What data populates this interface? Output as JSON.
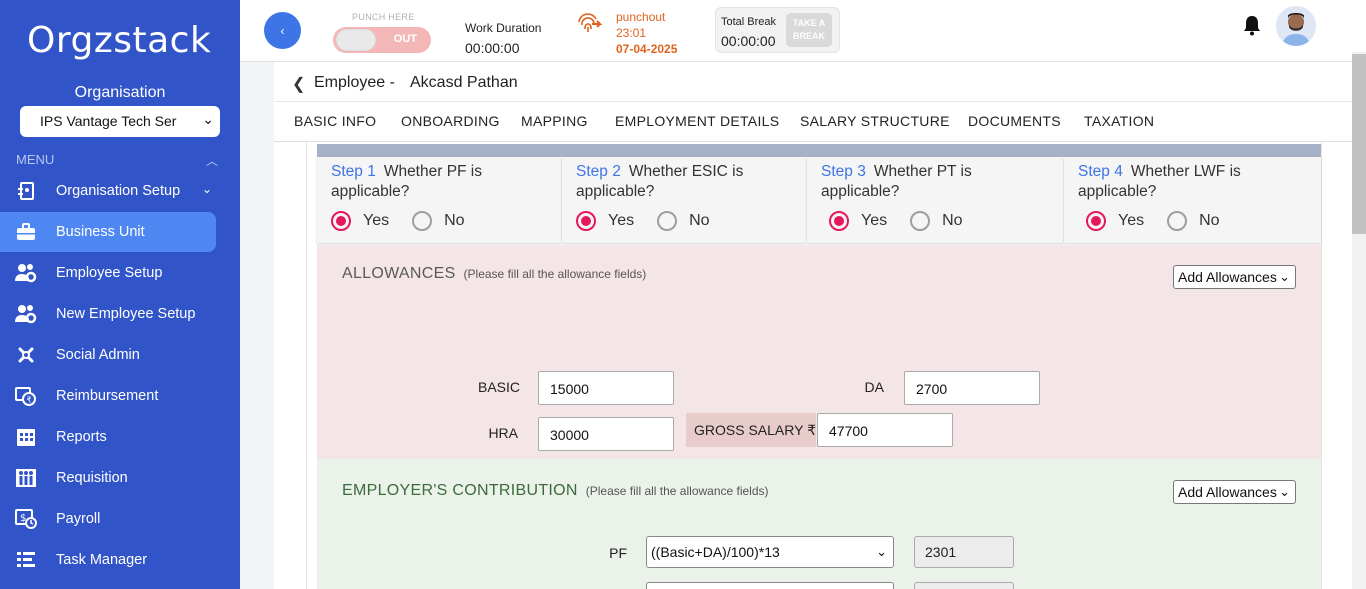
{
  "sidebar": {
    "logo": "Orgzstack",
    "org_label": "Organisation",
    "org_select_value": "IPS Vantage Tech Ser",
    "menu_label": "MENU",
    "items": [
      {
        "label": "Organisation Setup",
        "icon": "org-setup-icon"
      },
      {
        "label": "Business Unit",
        "icon": "briefcase-icon",
        "active": true
      },
      {
        "label": "Employee Setup",
        "icon": "users-gear-icon"
      },
      {
        "label": "New Employee Setup",
        "icon": "users-gear-icon"
      },
      {
        "label": "Social Admin",
        "icon": "social-icon"
      },
      {
        "label": "Reimbursement",
        "icon": "reimbursement-icon"
      },
      {
        "label": "Reports",
        "icon": "calendar-grid-icon"
      },
      {
        "label": "Requisition",
        "icon": "requisition-icon"
      },
      {
        "label": "Payroll",
        "icon": "payroll-icon"
      },
      {
        "label": "Task Manager",
        "icon": "task-list-icon"
      }
    ]
  },
  "topbar": {
    "punch_label": "PUNCH HERE",
    "toggle_text": "OUT",
    "work_duration_label": "Work Duration",
    "work_duration_value": "00:00:00",
    "punchout_label": "punchout",
    "punchout_time": "23:01",
    "punchout_date": "07-04-2025",
    "total_break_label": "Total Break",
    "total_break_value": "00:00:00",
    "take_break_line1": "TAKE A",
    "take_break_line2": "BREAK"
  },
  "employee": {
    "title": "Employee -",
    "name": "Akcasd Pathan"
  },
  "tabs": [
    "BASIC INFO",
    "ONBOARDING",
    "MAPPING",
    "EMPLOYMENT DETAILS",
    "SALARY STRUCTURE",
    "DOCUMENTS",
    "TAXATION"
  ],
  "steps": [
    {
      "num": "Step 1",
      "question": "Whether PF is applicable?",
      "yes": "Yes",
      "no": "No",
      "selected": "yes"
    },
    {
      "num": "Step 2",
      "question": "Whether ESIC is applicable?",
      "yes": "Yes",
      "no": "No",
      "selected": "yes"
    },
    {
      "num": "Step 3",
      "question": "Whether PT is applicable?",
      "yes": "Yes",
      "no": "No",
      "selected": "yes"
    },
    {
      "num": "Step 4",
      "question": "Whether LWF is applicable?",
      "yes": "Yes",
      "no": "No",
      "selected": "yes"
    }
  ],
  "allowances": {
    "title": "ALLOWANCES",
    "hint": "(Please fill all the allowance fields)",
    "add_button": "Add Allowances",
    "basic_label": "BASIC",
    "basic_value": "15000",
    "da_label": "DA",
    "da_value": "2700",
    "hra_label": "HRA",
    "hra_value": "30000",
    "gross_label": "GROSS SALARY ₹",
    "gross_value": "47700"
  },
  "employer_contribution": {
    "title": "EMPLOYER'S CONTRIBUTION",
    "hint": "(Please fill all the allowance fields)",
    "add_button": "Add Allowances",
    "pf_label": "PF",
    "pf_formula": "((Basic+DA)/100)*13",
    "pf_value": "2301"
  },
  "colors": {
    "sidebar_bg": "#3154c8",
    "active_item": "#4f87f2",
    "accent_blue": "#3d74e6",
    "radio_selected": "#e5175d",
    "punchout_orange": "#e0631d",
    "allowances_bg": "#f4e6e6",
    "employer_bg": "#eaf2ea"
  }
}
